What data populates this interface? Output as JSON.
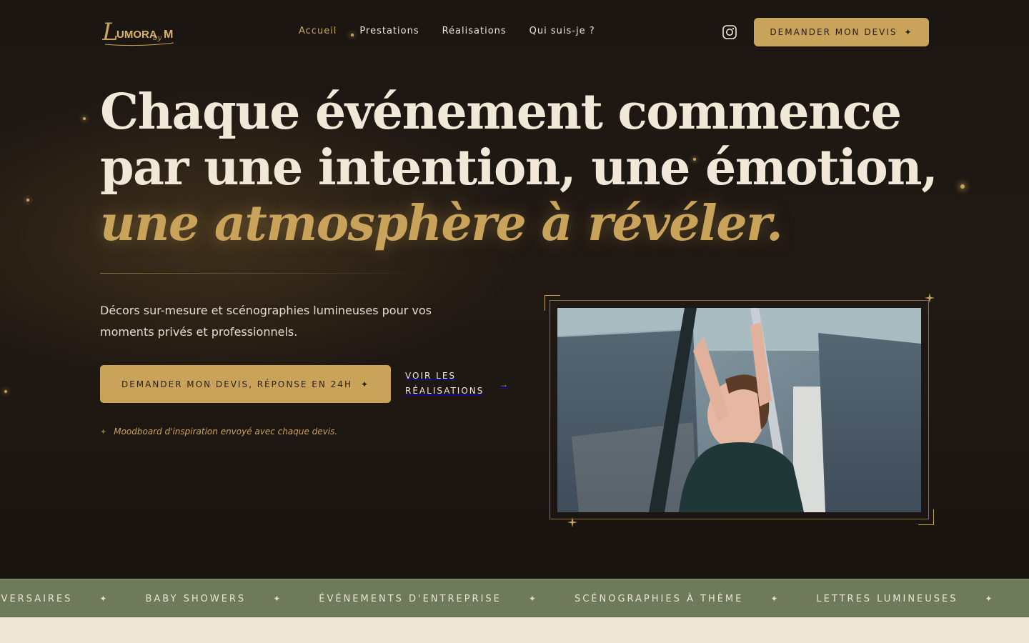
{
  "brand": {
    "logo_main": "UMORA",
    "logo_initial": "L",
    "logo_by": "by",
    "logo_m": "M"
  },
  "nav": {
    "items": [
      {
        "label": "Accueil",
        "active": true
      },
      {
        "label": "Prestations",
        "active": false
      },
      {
        "label": "Réalisations",
        "active": false
      },
      {
        "label": "Qui suis-je ?",
        "active": false
      }
    ],
    "instagram_icon": "instagram-icon",
    "cta_label": "DEMANDER MON DEVIS",
    "cta_icon": "✦"
  },
  "hero": {
    "headline_line1": "Chaque événement commence",
    "headline_line2": "par une intention, une émotion,",
    "headline_line3": "une atmosphère à révéler.",
    "lead": "Décors sur-mesure et scénographies lumineuses pour vos moments privés et professionnels.",
    "primary_cta": "DEMANDER MON DEVIS, RÉPONSE EN 24H",
    "primary_cta_icon": "✦",
    "secondary_cta": "VOIR LES RÉALISATIONS",
    "secondary_cta_icon": "→",
    "note": "Moodboard d'inspiration envoyé avec chaque devis.",
    "note_icon": "✦",
    "photo_alt": "Photo: woman setting up a decor structure"
  },
  "marquee": {
    "items": [
      "NIVERSAIRES",
      "BABY SHOWERS",
      "ÉVÉNEMENTS D'ENTREPRISE",
      "SCÉNOGRAPHIES À THÈME",
      "LETTRES LUMINEUSES"
    ],
    "separator": "✦"
  },
  "colors": {
    "background": "#1d1713",
    "gold": "#c9a35a",
    "cream": "#efe6d6",
    "sage": "#6e7a5a"
  }
}
